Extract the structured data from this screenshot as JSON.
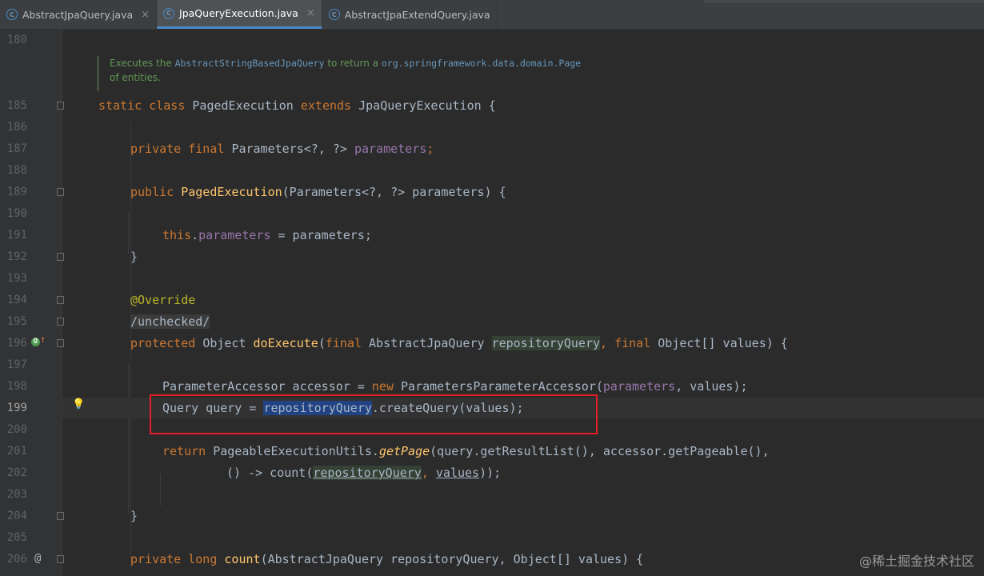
{
  "tabs": [
    {
      "label": "AbstractJpaQuery.java",
      "icon": "java-class-icon",
      "active": false
    },
    {
      "label": "JpaQueryExecution.java",
      "icon": "java-class-icon",
      "active": true
    },
    {
      "label": "AbstractJpaExtendQuery.java",
      "icon": "java-class-icon",
      "active": false
    }
  ],
  "tab_close": "×",
  "tab_icon_glyph": "C",
  "doc_comment": {
    "part1": "Executes the ",
    "code1": "AbstractStringBasedJpaQuery",
    "part2": " to return a ",
    "code2": "org.springframework.data.domain.Page",
    "part3": "of entities."
  },
  "line_numbers": [
    "180",
    "185",
    "186",
    "187",
    "188",
    "189",
    "190",
    "191",
    "192",
    "193",
    "194",
    "195",
    "196",
    "197",
    "198",
    "199",
    "200",
    "201",
    "202",
    "203",
    "204",
    "205",
    "206"
  ],
  "code": {
    "l185": {
      "kw1": "static class ",
      "name": "PagedExecution ",
      "kw2": "extends ",
      "rest": "JpaQueryExecution {"
    },
    "l187": {
      "kw": "private final ",
      "type": "Parameters<?, ?> ",
      "field": "parameters",
      "end": ";"
    },
    "l189": {
      "kw": "public ",
      "fn": "PagedExecution",
      "rest": "(Parameters<?, ?> parameters) {"
    },
    "l191": {
      "kw": "this",
      "dot": ".",
      "field": "parameters",
      "rest": " = parameters;"
    },
    "l192": {
      "rest": "}"
    },
    "l194": {
      "ann": "@Override"
    },
    "l195": {
      "text": "/unchecked/"
    },
    "l196": {
      "kw": "protected ",
      "type": "Object ",
      "fn": "doExecute",
      "p1": "(",
      "kw2": "final ",
      "t2": "AbstractJpaQuery ",
      "param": "repositoryQuery",
      "comma": ", ",
      "kw3": "final ",
      "rest": "Object[] values) {"
    },
    "l198": {
      "t": "ParameterAccessor accessor = ",
      "kw": "new ",
      "t2": "ParametersParameterAccessor(",
      "field": "parameters",
      "rest": ", values);"
    },
    "l199": {
      "t": "Query query = ",
      "sel": "repositoryQuery",
      "rest": ".createQuery(values);"
    },
    "l201": {
      "kw": "return ",
      "t": "PageableExecutionUtils.",
      "fn": "getPage",
      "rest": "(query.getResultList(), accessor.getPageable(),"
    },
    "l202": {
      "t": "() -> count(",
      "p1": "repositoryQuery",
      "comma": ", ",
      "p2": "values",
      "rest": "));"
    },
    "l204": {
      "rest": "}"
    },
    "l206": {
      "kw": "private long ",
      "fn": "count",
      "rest": "(AbstractJpaQuery repositoryQuery, Object[] values) {"
    }
  },
  "gutter_marks": {
    "override": "O",
    "override_arrow": "↑",
    "at": "@",
    "bulb": "💡"
  },
  "watermark": "@稀土掘金技术社区",
  "colors": {
    "background": "#2b2b2b",
    "keyword": "#cc7832",
    "field": "#9876aa",
    "function": "#ffc66d",
    "annotation": "#bbb529",
    "text": "#a9b7c6",
    "selection": "#214283",
    "highlight_box": "#e31e24"
  }
}
